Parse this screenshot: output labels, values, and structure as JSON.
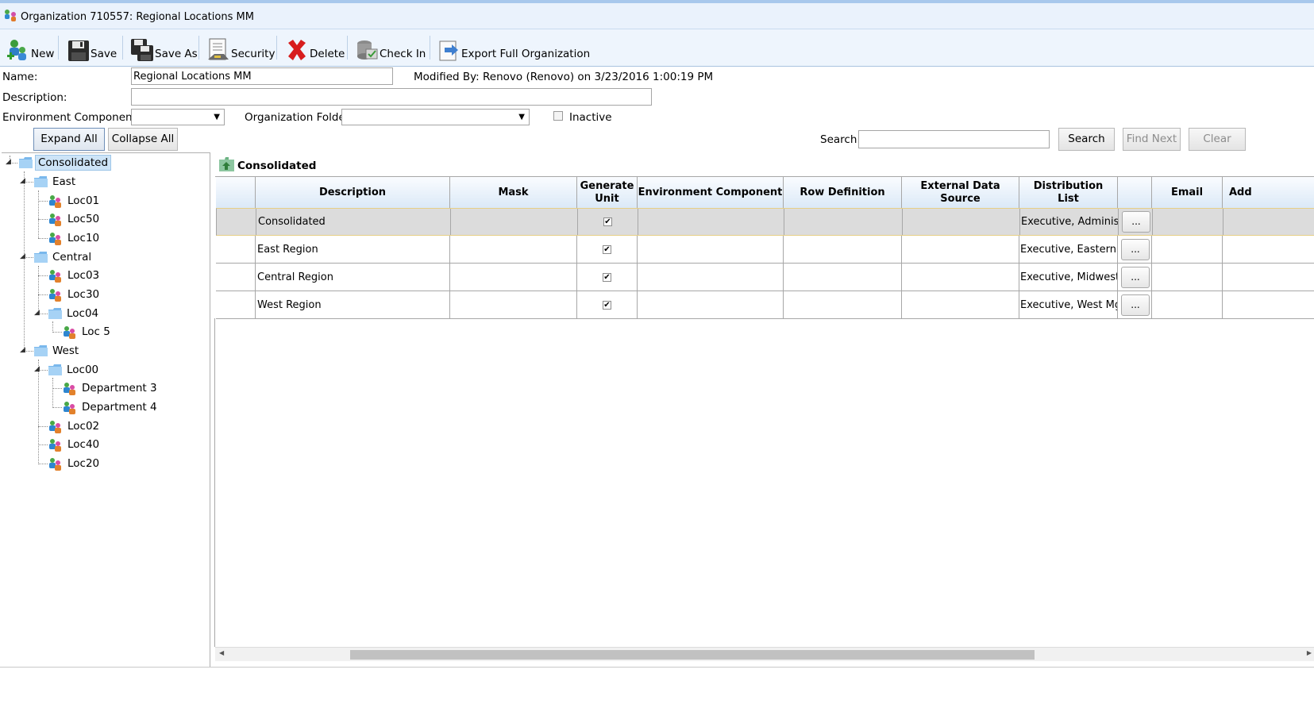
{
  "window": {
    "title": "Organization 710557: Regional Locations MM"
  },
  "toolbar": {
    "new": "New",
    "save": "Save",
    "save_as": "Save As",
    "security": "Security",
    "delete": "Delete",
    "check_in": "Check In",
    "export": "Export Full Organization"
  },
  "form": {
    "name_label": "Name:",
    "name_value": "Regional Locations MM",
    "modified": "Modified By: Renovo (Renovo) on 3/23/2016 1:00:19 PM",
    "description_label": "Description:",
    "description_value": "",
    "env_label": "Environment Component:",
    "env_value": "",
    "folder_label": "Organization Folder:",
    "folder_value": "",
    "inactive_label": "Inactive",
    "inactive_checked": false
  },
  "actions": {
    "expand_all": "Expand All",
    "collapse_all": "Collapse All",
    "search_label": "Search:",
    "search_value": "",
    "search": "Search",
    "find_next": "Find Next",
    "clear": "Clear"
  },
  "tree": {
    "root": "Consolidated",
    "east": "East",
    "loc01": "Loc01",
    "loc50": "Loc50",
    "loc10": "Loc10",
    "central": "Central",
    "loc03": "Loc03",
    "loc30": "Loc30",
    "loc04": "Loc04",
    "loc5": "Loc 5",
    "west": "West",
    "loc00": "Loc00",
    "dept3": "Department 3",
    "dept4": "Department 4",
    "loc02": "Loc02",
    "loc40": "Loc40",
    "loc20": "Loc20"
  },
  "panel": {
    "title": "Consolidated"
  },
  "grid": {
    "headers": {
      "description": "Description",
      "mask": "Mask",
      "generate_unit": "Generate Unit",
      "env_component": "Environment Component",
      "row_definition": "Row Definition",
      "external_source": "External Data Source",
      "distribution_list": "Distribution List",
      "email": "Email",
      "add": "Add"
    },
    "rows": [
      {
        "description": "Consolidated",
        "generate": true,
        "distribution": "Executive, Administ...",
        "button": "..."
      },
      {
        "description": "East Region",
        "generate": true,
        "distribution": "Executive, Eastern ...",
        "button": "..."
      },
      {
        "description": "Central Region",
        "generate": true,
        "distribution": "Executive, Midwest ...",
        "button": "..."
      },
      {
        "description": "West Region",
        "generate": true,
        "distribution": "Executive, West Mgrs",
        "button": "..."
      }
    ]
  },
  "colors": {
    "titlebar": "#eaf2fc",
    "header_gradient_end": "#dbe9f7",
    "selection": "#cde4f7",
    "delete_red": "#d71d1d"
  }
}
